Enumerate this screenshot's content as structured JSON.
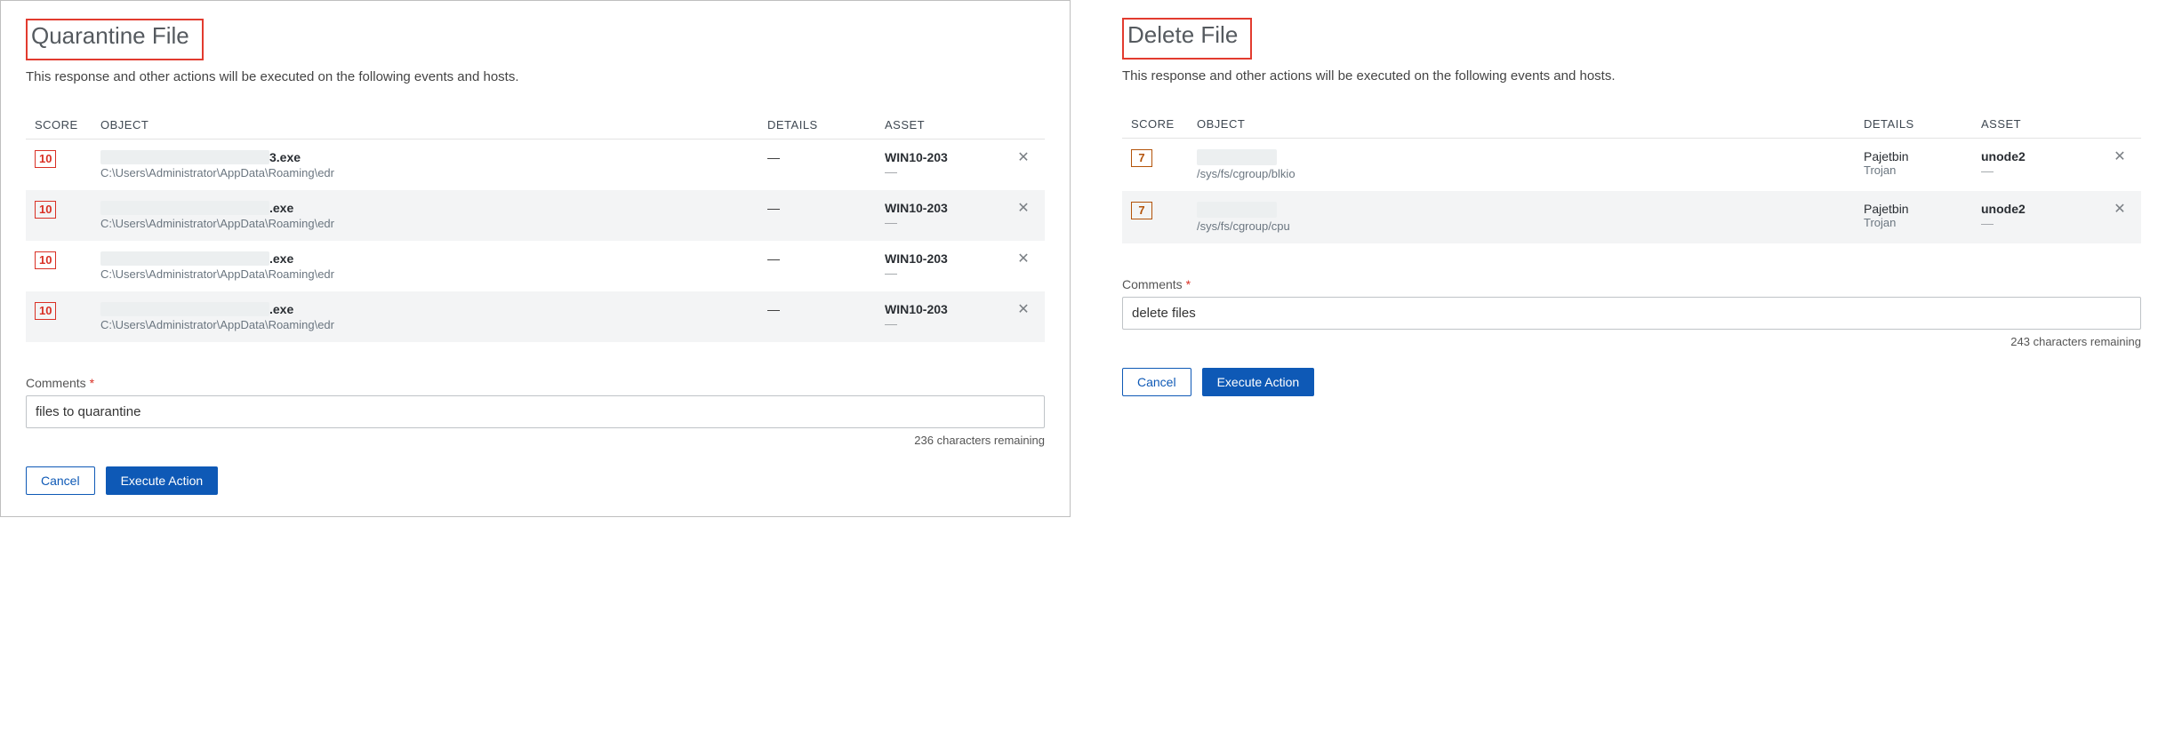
{
  "left": {
    "title": "Quarantine File",
    "subtitle": "This response and other actions will be executed on the following events and hosts.",
    "columns": {
      "score": "SCORE",
      "object": "OBJECT",
      "details": "DETAILS",
      "asset": "ASSET"
    },
    "rows": [
      {
        "score": "10",
        "name_tail": "3.exe",
        "path": "C:\\Users\\Administrator\\AppData\\Roaming\\edr",
        "details_main": "—",
        "asset": "WIN10-203",
        "asset_sub": "—"
      },
      {
        "score": "10",
        "name_tail": ".exe",
        "path": "C:\\Users\\Administrator\\AppData\\Roaming\\edr",
        "details_main": "—",
        "asset": "WIN10-203",
        "asset_sub": "—"
      },
      {
        "score": "10",
        "name_tail": ".exe",
        "path": "C:\\Users\\Administrator\\AppData\\Roaming\\edr",
        "details_main": "—",
        "asset": "WIN10-203",
        "asset_sub": "—"
      },
      {
        "score": "10",
        "name_tail": ".exe",
        "path": "C:\\Users\\Administrator\\AppData\\Roaming\\edr",
        "details_main": "—",
        "asset": "WIN10-203",
        "asset_sub": "—"
      }
    ],
    "comments_label": "Comments",
    "required_mark": "*",
    "comment_value": "files to quarantine",
    "chars_remaining": "236 characters remaining",
    "cancel": "Cancel",
    "execute": "Execute Action"
  },
  "right": {
    "title": "Delete File",
    "subtitle": "This response and other actions will be executed on the following events and hosts.",
    "columns": {
      "score": "SCORE",
      "object": "OBJECT",
      "details": "DETAILS",
      "asset": "ASSET"
    },
    "rows": [
      {
        "score": "7",
        "path": "/sys/fs/cgroup/blkio",
        "details_main": "Pajetbin",
        "details_sub": "Trojan",
        "asset": "unode2",
        "asset_sub": "—"
      },
      {
        "score": "7",
        "path": "/sys/fs/cgroup/cpu",
        "details_main": "Pajetbin",
        "details_sub": "Trojan",
        "asset": "unode2",
        "asset_sub": "—"
      }
    ],
    "comments_label": "Comments",
    "required_mark": "*",
    "comment_value": "delete files",
    "chars_remaining": "243 characters remaining",
    "cancel": "Cancel",
    "execute": "Execute Action"
  }
}
